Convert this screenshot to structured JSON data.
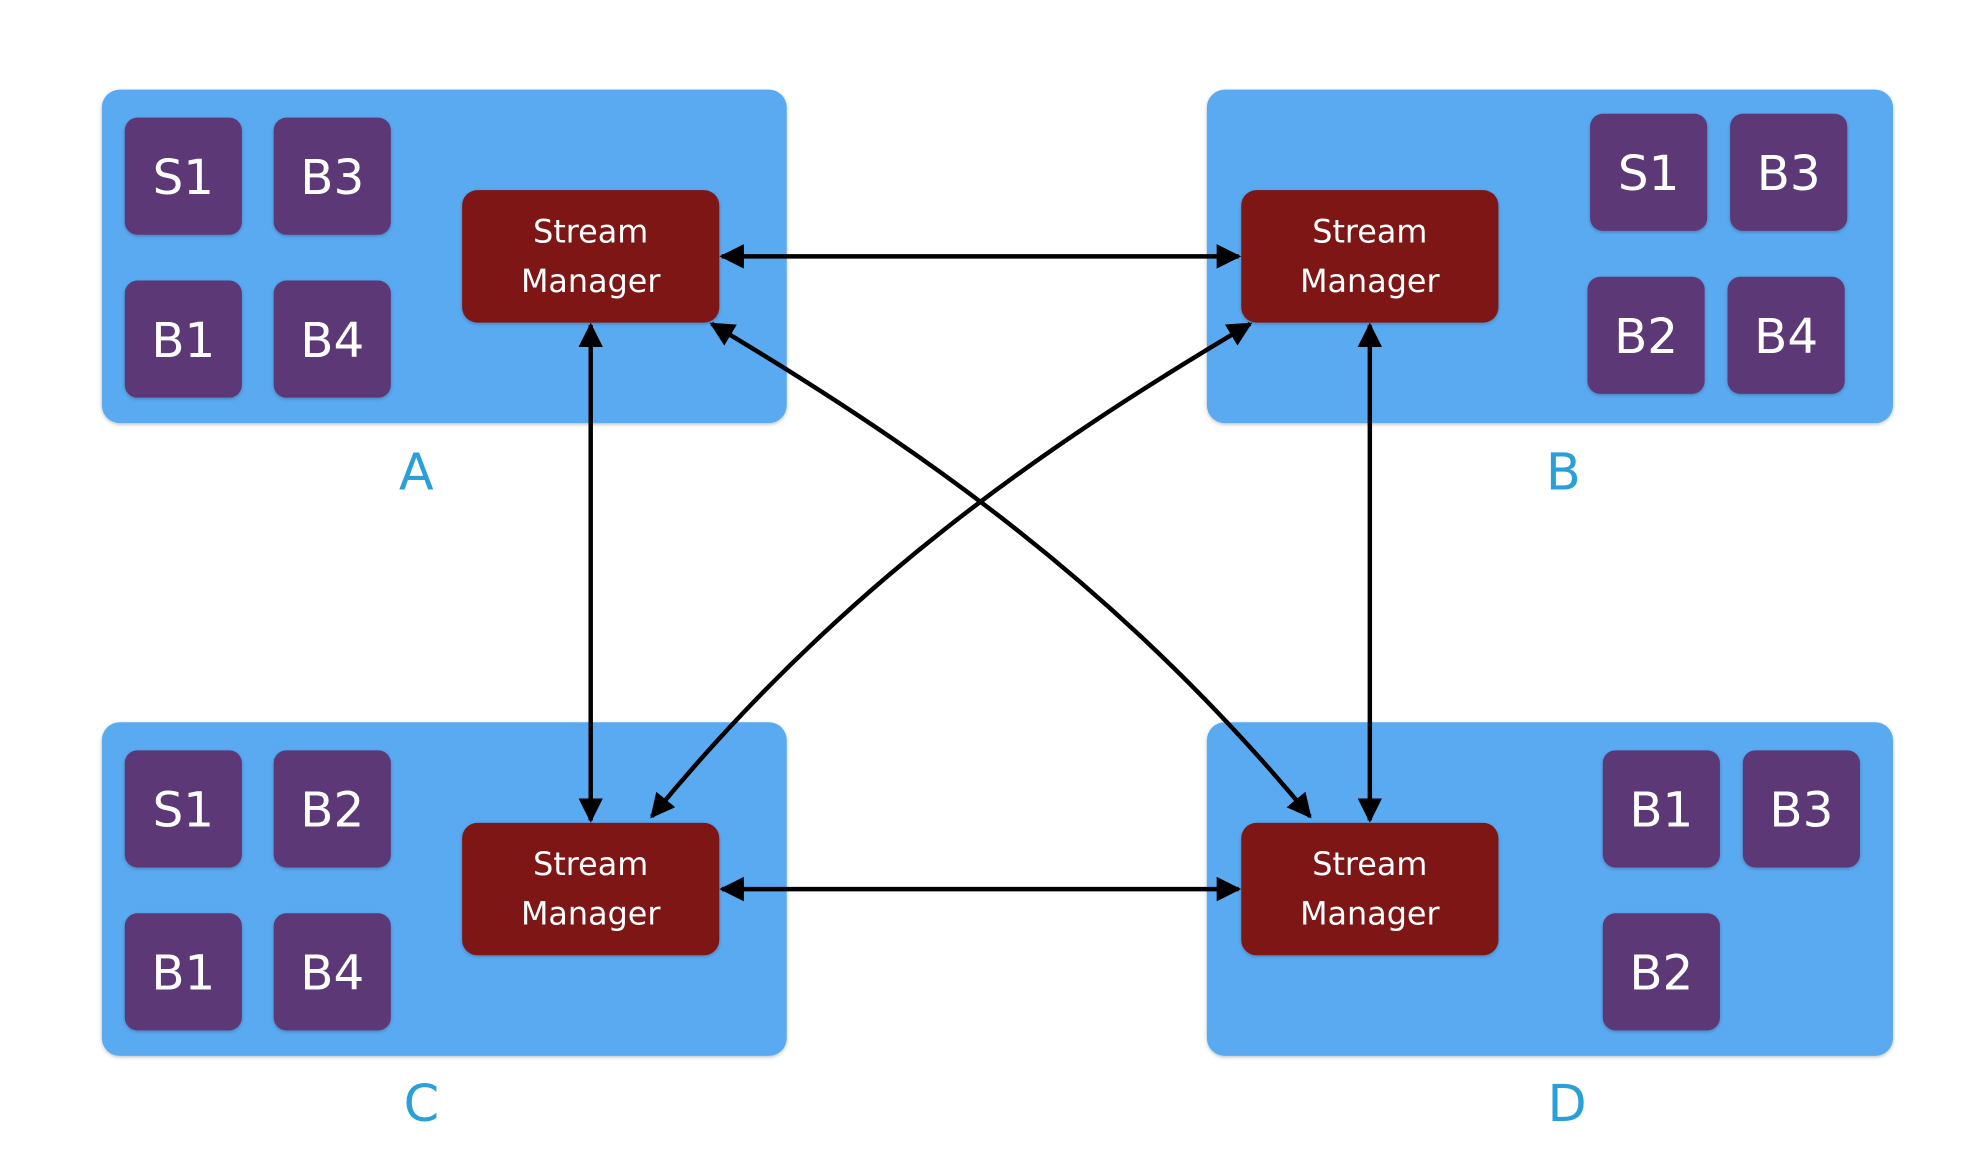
{
  "colors": {
    "host_box": "#5aaaf2",
    "task_box": "#5b3776",
    "stream_manager": "#7e1513",
    "host_label": "#2a9fd8",
    "arrow": "#000000",
    "text_light": "#ffffff"
  },
  "hosts": [
    {
      "label": "A",
      "stream_manager": {
        "line1": "Stream",
        "line2": "Manager"
      },
      "tasks": [
        "S1",
        "B3",
        "B1",
        "B4"
      ]
    },
    {
      "label": "B",
      "stream_manager": {
        "line1": "Stream",
        "line2": "Manager"
      },
      "tasks": [
        "S1",
        "B3",
        "B2",
        "B4"
      ]
    },
    {
      "label": "C",
      "stream_manager": {
        "line1": "Stream",
        "line2": "Manager"
      },
      "tasks": [
        "S1",
        "B2",
        "B1",
        "B4"
      ]
    },
    {
      "label": "D",
      "stream_manager": {
        "line1": "Stream",
        "line2": "Manager"
      },
      "tasks": [
        "B1",
        "B3",
        "B2"
      ]
    }
  ],
  "connections": [
    {
      "from": "A",
      "to": "B",
      "bidirectional": true
    },
    {
      "from": "C",
      "to": "D",
      "bidirectional": true
    },
    {
      "from": "A",
      "to": "C",
      "bidirectional": true
    },
    {
      "from": "B",
      "to": "D",
      "bidirectional": true
    },
    {
      "from": "A",
      "to": "D",
      "bidirectional": true
    },
    {
      "from": "B",
      "to": "C",
      "bidirectional": true
    }
  ]
}
